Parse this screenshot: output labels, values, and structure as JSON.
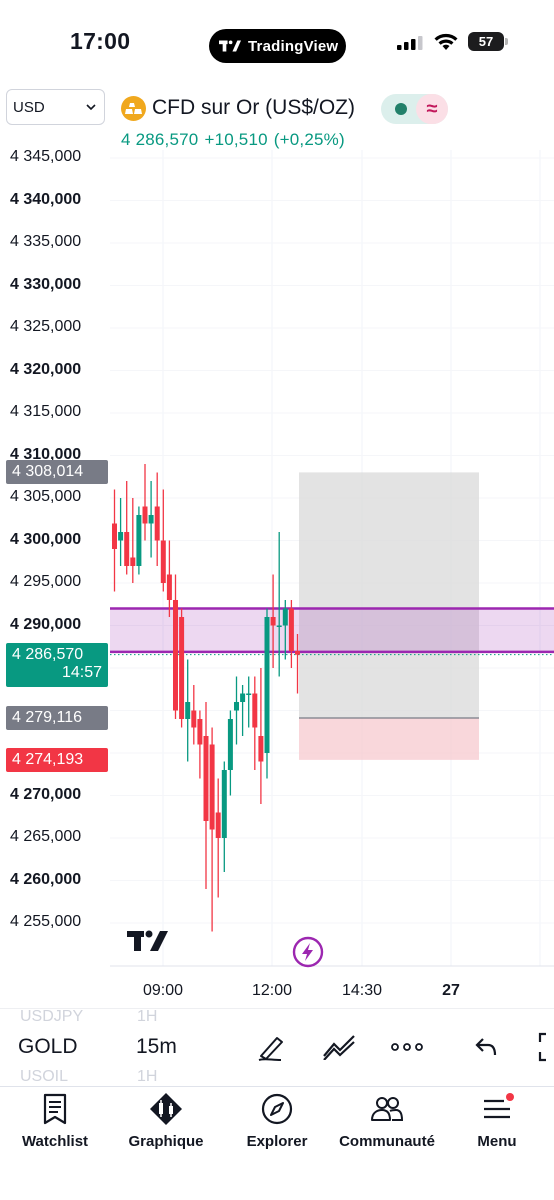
{
  "status_bar": {
    "time": "17:00",
    "app_pill": "TradingView",
    "battery_level": "57"
  },
  "header": {
    "currency": "USD",
    "symbol_title": "CFD sur Or (US$/OZ)",
    "last_price": "4 286,570",
    "change": "+10,510",
    "change_pct": "(+0,25%)",
    "symbol_icon": "gold-bars-icon"
  },
  "price_axis": {
    "labels": [
      {
        "text": "4 345,000",
        "value": 4345,
        "bold": false
      },
      {
        "text": "4 340,000",
        "value": 4340,
        "bold": true
      },
      {
        "text": "4 335,000",
        "value": 4335,
        "bold": false
      },
      {
        "text": "4 330,000",
        "value": 4330,
        "bold": true
      },
      {
        "text": "4 325,000",
        "value": 4325,
        "bold": false
      },
      {
        "text": "4 320,000",
        "value": 4320,
        "bold": true
      },
      {
        "text": "4 315,000",
        "value": 4315,
        "bold": false
      },
      {
        "text": "4 310,000",
        "value": 4310,
        "bold": true
      },
      {
        "text": "4 305,000",
        "value": 4305,
        "bold": false
      },
      {
        "text": "4 300,000",
        "value": 4300,
        "bold": true
      },
      {
        "text": "4 295,000",
        "value": 4295,
        "bold": false
      },
      {
        "text": "4 290,000",
        "value": 4290,
        "bold": true
      },
      {
        "text": "4 270,000",
        "value": 4270,
        "bold": true
      },
      {
        "text": "4 265,000",
        "value": 4265,
        "bold": false
      },
      {
        "text": "4 260,000",
        "value": 4260,
        "bold": true
      },
      {
        "text": "4 255,000",
        "value": 4255,
        "bold": false
      }
    ],
    "badges": [
      {
        "text": "4 308,014",
        "sub": "",
        "value": 4308.014,
        "color": "#787b86"
      },
      {
        "text": "4 286,570",
        "sub": "14:57",
        "value": 4286.57,
        "color": "#089981"
      },
      {
        "text": "4 279,116",
        "sub": "",
        "value": 4279.116,
        "color": "#787b86"
      },
      {
        "text": "4 274,193",
        "sub": "",
        "value": 4274.193,
        "color": "#f23645"
      }
    ]
  },
  "time_axis": [
    {
      "text": "09:00",
      "bold": false
    },
    {
      "text": "12:00",
      "bold": false
    },
    {
      "text": "14:30",
      "bold": false
    },
    {
      "text": "27",
      "bold": true
    }
  ],
  "chart_data": {
    "type": "candlestick",
    "title": "",
    "ylim": [
      4250,
      4350
    ],
    "up_color": "#089981",
    "down_color": "#f23645",
    "candles": [
      {
        "o": 4302,
        "h": 4306,
        "l": 4294,
        "c": 4299
      },
      {
        "o": 4300,
        "h": 4305,
        "l": 4297,
        "c": 4301
      },
      {
        "o": 4301,
        "h": 4307,
        "l": 4296,
        "c": 4297
      },
      {
        "o": 4298,
        "h": 4305,
        "l": 4295,
        "c": 4297
      },
      {
        "o": 4297,
        "h": 4304,
        "l": 4296,
        "c": 4303
      },
      {
        "o": 4304,
        "h": 4309,
        "l": 4300,
        "c": 4302
      },
      {
        "o": 4302,
        "h": 4307,
        "l": 4298,
        "c": 4303
      },
      {
        "o": 4304,
        "h": 4308,
        "l": 4297,
        "c": 4300
      },
      {
        "o": 4300,
        "h": 4306,
        "l": 4294,
        "c": 4295
      },
      {
        "o": 4296,
        "h": 4300,
        "l": 4291,
        "c": 4293
      },
      {
        "o": 4293,
        "h": 4296,
        "l": 4279,
        "c": 4280
      },
      {
        "o": 4291,
        "h": 4292,
        "l": 4278,
        "c": 4279
      },
      {
        "o": 4279,
        "h": 4286,
        "l": 4274,
        "c": 4281
      },
      {
        "o": 4280,
        "h": 4283,
        "l": 4276,
        "c": 4278
      },
      {
        "o": 4279,
        "h": 4280,
        "l": 4272,
        "c": 4276
      },
      {
        "o": 4277,
        "h": 4281,
        "l": 4259,
        "c": 4267
      },
      {
        "o": 4276,
        "h": 4278,
        "l": 4254,
        "c": 4266
      },
      {
        "o": 4268,
        "h": 4272,
        "l": 4258,
        "c": 4265
      },
      {
        "o": 4265,
        "h": 4274,
        "l": 4261,
        "c": 4273
      },
      {
        "o": 4273,
        "h": 4280,
        "l": 4270,
        "c": 4279
      },
      {
        "o": 4280,
        "h": 4284,
        "l": 4276,
        "c": 4281
      },
      {
        "o": 4281,
        "h": 4283,
        "l": 4277,
        "c": 4282
      },
      {
        "o": 4282,
        "h": 4284,
        "l": 4278,
        "c": 4282
      },
      {
        "o": 4282,
        "h": 4284,
        "l": 4273,
        "c": 4278
      },
      {
        "o": 4277,
        "h": 4285,
        "l": 4269,
        "c": 4274
      },
      {
        "o": 4275,
        "h": 4292,
        "l": 4272,
        "c": 4291
      },
      {
        "o": 4291,
        "h": 4296,
        "l": 4285,
        "c": 4290
      },
      {
        "o": 4290,
        "h": 4301,
        "l": 4284,
        "c": 4290
      },
      {
        "o": 4290,
        "h": 4293,
        "l": 4286,
        "c": 4292
      },
      {
        "o": 4292,
        "h": 4293,
        "l": 4285,
        "c": 4287
      },
      {
        "o": 4287,
        "h": 4289,
        "l": 4282,
        "c": 4286.57
      }
    ],
    "horizontal_band": {
      "upper": 4292,
      "lower": 4286.9,
      "color": "#9c27b0"
    },
    "last_price": 4286.57,
    "position_box": {
      "top": 4308.014,
      "entry": 4279.116,
      "stop": 4274.193
    }
  },
  "toolbar": {
    "ghost_above_symbol": "USDJPY",
    "ghost_above_interval": "1H",
    "symbol": "GOLD",
    "interval": "15m",
    "ghost_below_symbol": "USOIL",
    "ghost_below_interval": "1H",
    "icons": [
      "draw-pen-icon",
      "indicators-icon",
      "more-dots-icon",
      "undo-icon",
      "fullscreen-icon"
    ]
  },
  "tabs": [
    {
      "label": "Watchlist",
      "icon": "watchlist-icon"
    },
    {
      "label": "Graphique",
      "icon": "chart-icon"
    },
    {
      "label": "Explorer",
      "icon": "compass-icon"
    },
    {
      "label": "Communauté",
      "icon": "community-icon"
    },
    {
      "label": "Menu",
      "icon": "menu-icon"
    }
  ],
  "colors": {
    "accent_green": "#089981",
    "accent_red": "#f23645",
    "band_purple": "#9c27b0",
    "notification_dot": "#f23645"
  }
}
